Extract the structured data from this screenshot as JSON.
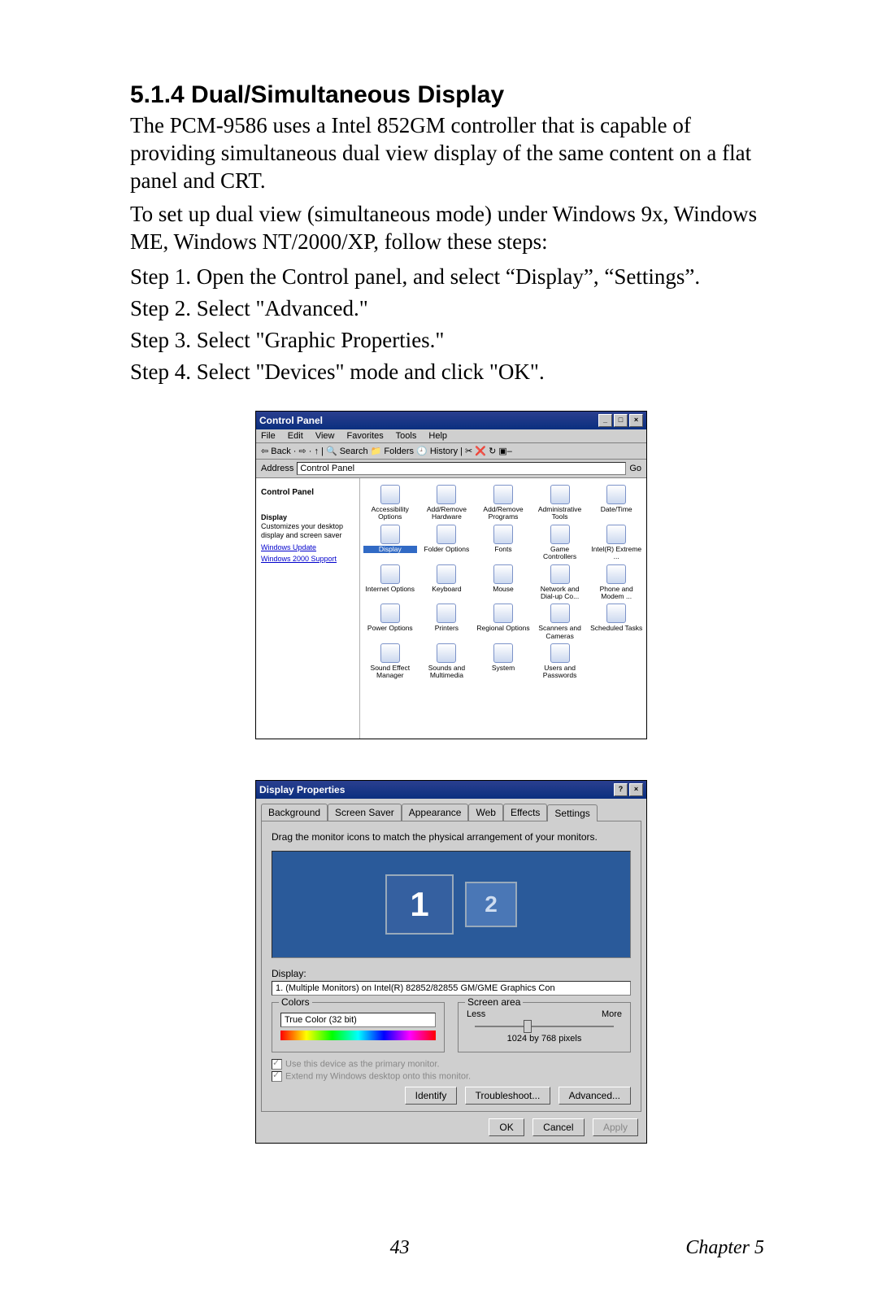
{
  "doc": {
    "heading": "5.1.4 Dual/Simultaneous Display",
    "p1": "The PCM-9586 uses a Intel 852GM controller that is capable of providing simultaneous dual view display of the same content on a flat panel and CRT.",
    "p2": "To set up dual view (simultaneous mode) under Windows 9x, Windows ME, Windows NT/2000/XP, follow these steps:",
    "steps": [
      "Step 1.  Open the Control panel, and select “Display”, “Settings”.",
      "Step 2.  Select \"Advanced.\"",
      "Step 3.  Select \"Graphic Properties.\"",
      "Step 4.  Select \"Devices\" mode and click \"OK\"."
    ],
    "page_number": "43",
    "chapter": "Chapter 5"
  },
  "cp": {
    "title": "Control Panel",
    "menu": [
      "File",
      "Edit",
      "View",
      "Favorites",
      "Tools",
      "Help"
    ],
    "toolbar_text": "⇦ Back · ⇨ · ↑  | 🔍 Search  📁 Folders  🕘 History  |  ✂ ❌ ↻  ▣–",
    "address_label": "Address",
    "address_value": "Control Panel",
    "go": "Go",
    "side_title": "Control Panel",
    "side_section": "Display",
    "side_desc": "Customizes your desktop display and screen saver",
    "links": [
      "Windows Update",
      "Windows 2000 Support"
    ],
    "icons": [
      "Accessibility Options",
      "Add/Remove Hardware",
      "Add/Remove Programs",
      "Administrative Tools",
      "Date/Time",
      "Display",
      "Folder Options",
      "Fonts",
      "Game Controllers",
      "Intel(R) Extreme ...",
      "Internet Options",
      "Keyboard",
      "Mouse",
      "Network and Dial-up Co...",
      "Phone and Modem ...",
      "Power Options",
      "Printers",
      "Regional Options",
      "Scanners and Cameras",
      "Scheduled Tasks",
      "Sound Effect Manager",
      "Sounds and Multimedia",
      "System",
      "Users and Passwords"
    ],
    "selected_index": 5
  },
  "dp": {
    "title": "Display Properties",
    "tabs": [
      "Background",
      "Screen Saver",
      "Appearance",
      "Web",
      "Effects",
      "Settings"
    ],
    "active_tab": 5,
    "hint": "Drag the monitor icons to match the physical arrangement of your monitors.",
    "mon1": "1",
    "mon2": "2",
    "display_label": "Display:",
    "display_value": "1. (Multiple Monitors) on Intel(R) 82852/82855 GM/GME Graphics Con",
    "colors_label": "Colors",
    "colors_value": "True Color (32 bit)",
    "screen_label": "Screen area",
    "less": "Less",
    "more": "More",
    "resolution": "1024 by 768 pixels",
    "check1": "Use this device as the primary monitor.",
    "check2": "Extend my Windows desktop onto this monitor.",
    "identify": "Identify",
    "troubleshoot": "Troubleshoot...",
    "advanced": "Advanced...",
    "ok": "OK",
    "cancel": "Cancel",
    "apply": "Apply"
  }
}
